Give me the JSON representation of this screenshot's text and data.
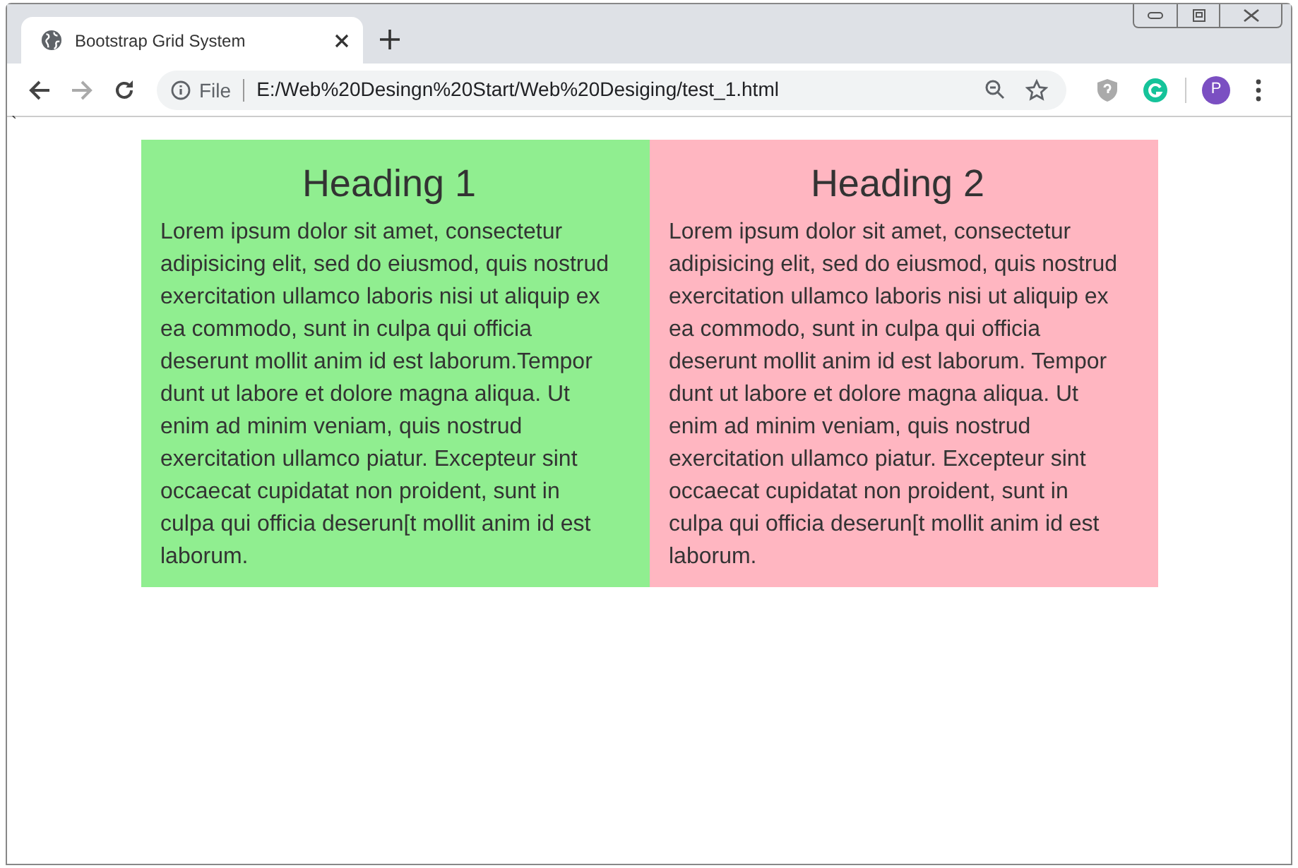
{
  "browser": {
    "tab": {
      "title": "Bootstrap Grid System",
      "selected": true
    },
    "address": {
      "scheme": "File",
      "url": "E:/Web%20Desingn%20Start/Web%20Desiging/test_1.html"
    },
    "profile": "P"
  },
  "page": {
    "stray_text": "`",
    "columns": [
      {
        "heading": "Heading 1",
        "color": "#90ee90",
        "text": "Lorem ipsum dolor sit amet, consectetur adipisicing elit, sed do eiusmod, quis nostrud exercitation ullamco laboris nisi ut aliquip ex ea commodo, sunt in culpa qui officia deserunt mollit anim id est laborum.Tempor dunt ut labore et dolore magna aliqua. Ut enim ad minim veniam, quis nostrud exercitation ullamco piatur. Excepteur sint occaecat cupidatat non proident, sunt in culpa qui officia deserun[t mollit anim id est laborum."
      },
      {
        "heading": "Heading 2",
        "color": "#ffb6c1",
        "text": "Lorem ipsum dolor sit amet, consectetur adipisicing elit, sed do eiusmod, quis nostrud exercitation ullamco laboris nisi ut aliquip ex ea commodo, sunt in culpa qui officia deserunt mollit anim id est laborum. Tempor dunt ut labore et dolore magna aliqua. Ut enim ad minim veniam, quis nostrud exercitation ullamco piatur. Excepteur sint occaecat cupidatat non proident, sunt in culpa qui officia deserun[t mollit anim id est laborum."
      }
    ]
  }
}
